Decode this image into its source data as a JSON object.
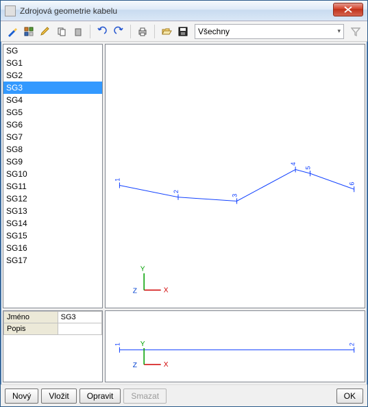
{
  "window": {
    "title": "Zdrojová geometrie kabelu",
    "close_tooltip": "Close"
  },
  "toolbar": {
    "filter_select": "Všechny"
  },
  "list": {
    "items": [
      "SG",
      "SG1",
      "SG2",
      "SG3",
      "SG4",
      "SG5",
      "SG6",
      "SG7",
      "SG8",
      "SG9",
      "SG10",
      "SG11",
      "SG12",
      "SG13",
      "SG14",
      "SG15",
      "SG16",
      "SG17"
    ],
    "selected_index": 3
  },
  "props": {
    "rows": [
      {
        "key": "Jméno",
        "value": "SG3"
      },
      {
        "key": "Popis",
        "value": ""
      }
    ]
  },
  "chart_data": [
    {
      "type": "line",
      "title": "",
      "axes": {
        "xlabel": "X",
        "ylabel": "Y",
        "zlabel": "Z"
      },
      "nodes": [
        {
          "id": 1,
          "x": 0,
          "y": 0.1
        },
        {
          "id": 2,
          "x": 20,
          "y": -0.2
        },
        {
          "id": 3,
          "x": 40,
          "y": -0.3
        },
        {
          "id": 4,
          "x": 60,
          "y": 0.5
        },
        {
          "id": 5,
          "x": 65,
          "y": 0.4
        },
        {
          "id": 6,
          "x": 80,
          "y": 0.0
        }
      ],
      "ylim": [
        -1,
        1
      ]
    },
    {
      "type": "line",
      "title": "",
      "axes": {
        "xlabel": "X",
        "ylabel": "Y",
        "zlabel": "Z"
      },
      "nodes": [
        {
          "id": 1,
          "x": 0,
          "y": 0
        },
        {
          "id": 2,
          "x": 80,
          "y": 0
        }
      ],
      "ylim": [
        -1,
        1
      ]
    }
  ],
  "footer": {
    "new_label": "Nový",
    "paste_label": "Vložit",
    "edit_label": "Opravit",
    "delete_label": "Smazat",
    "ok_label": "OK"
  }
}
